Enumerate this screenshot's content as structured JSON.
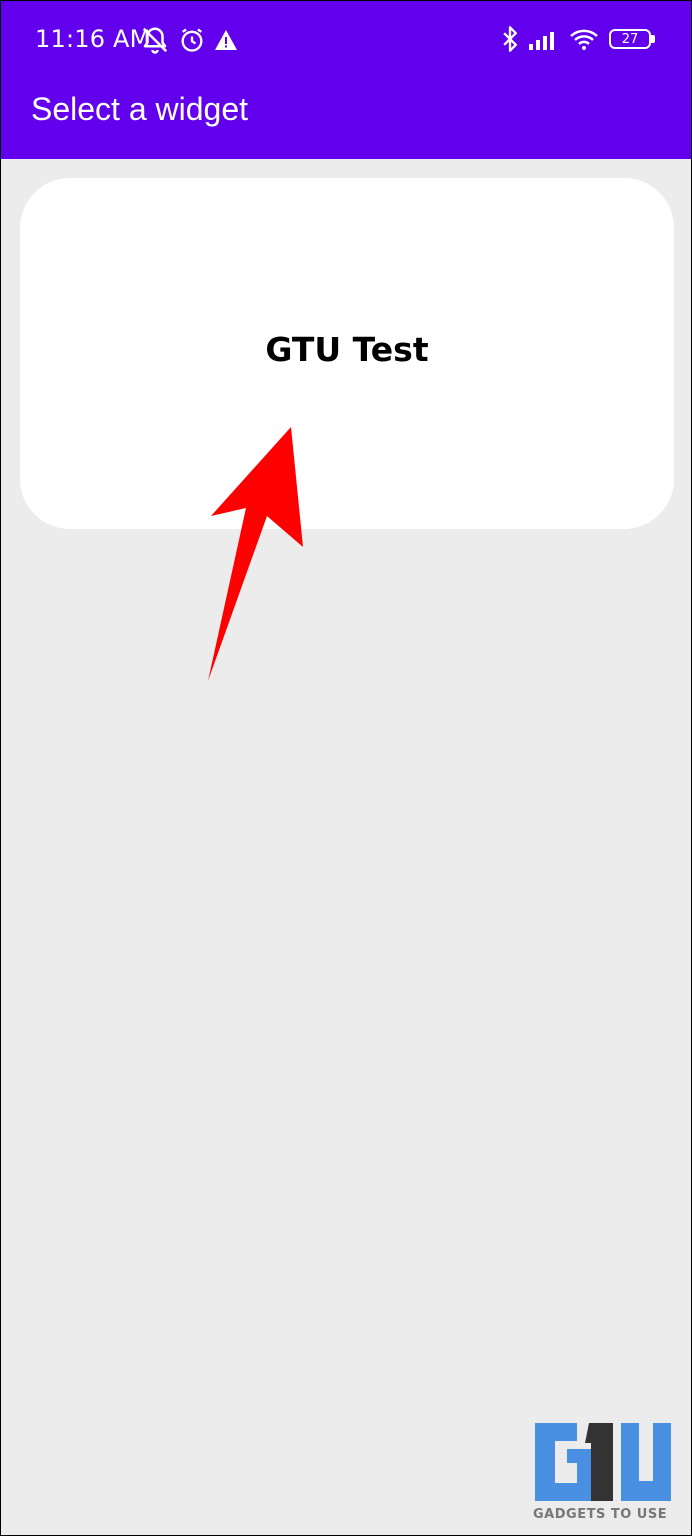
{
  "status_bar": {
    "time": "11:16 AM",
    "icons_left": [
      "muted-notifications-icon",
      "alarm-icon",
      "warning-icon"
    ],
    "icons_right": [
      "bluetooth-icon",
      "signal-icon",
      "wifi-icon",
      "battery-icon"
    ],
    "battery_level": "27"
  },
  "app_bar": {
    "title": "Select a widget",
    "color": "#6200ee"
  },
  "widget": {
    "label": "GTU Test"
  },
  "annotation": {
    "type": "red-arrow",
    "color": "#ff0000"
  },
  "watermark": {
    "logo_text": "G1U",
    "brand": "GADGETS TO USE",
    "color": "#4a90e2"
  },
  "background_color": "#ececec"
}
